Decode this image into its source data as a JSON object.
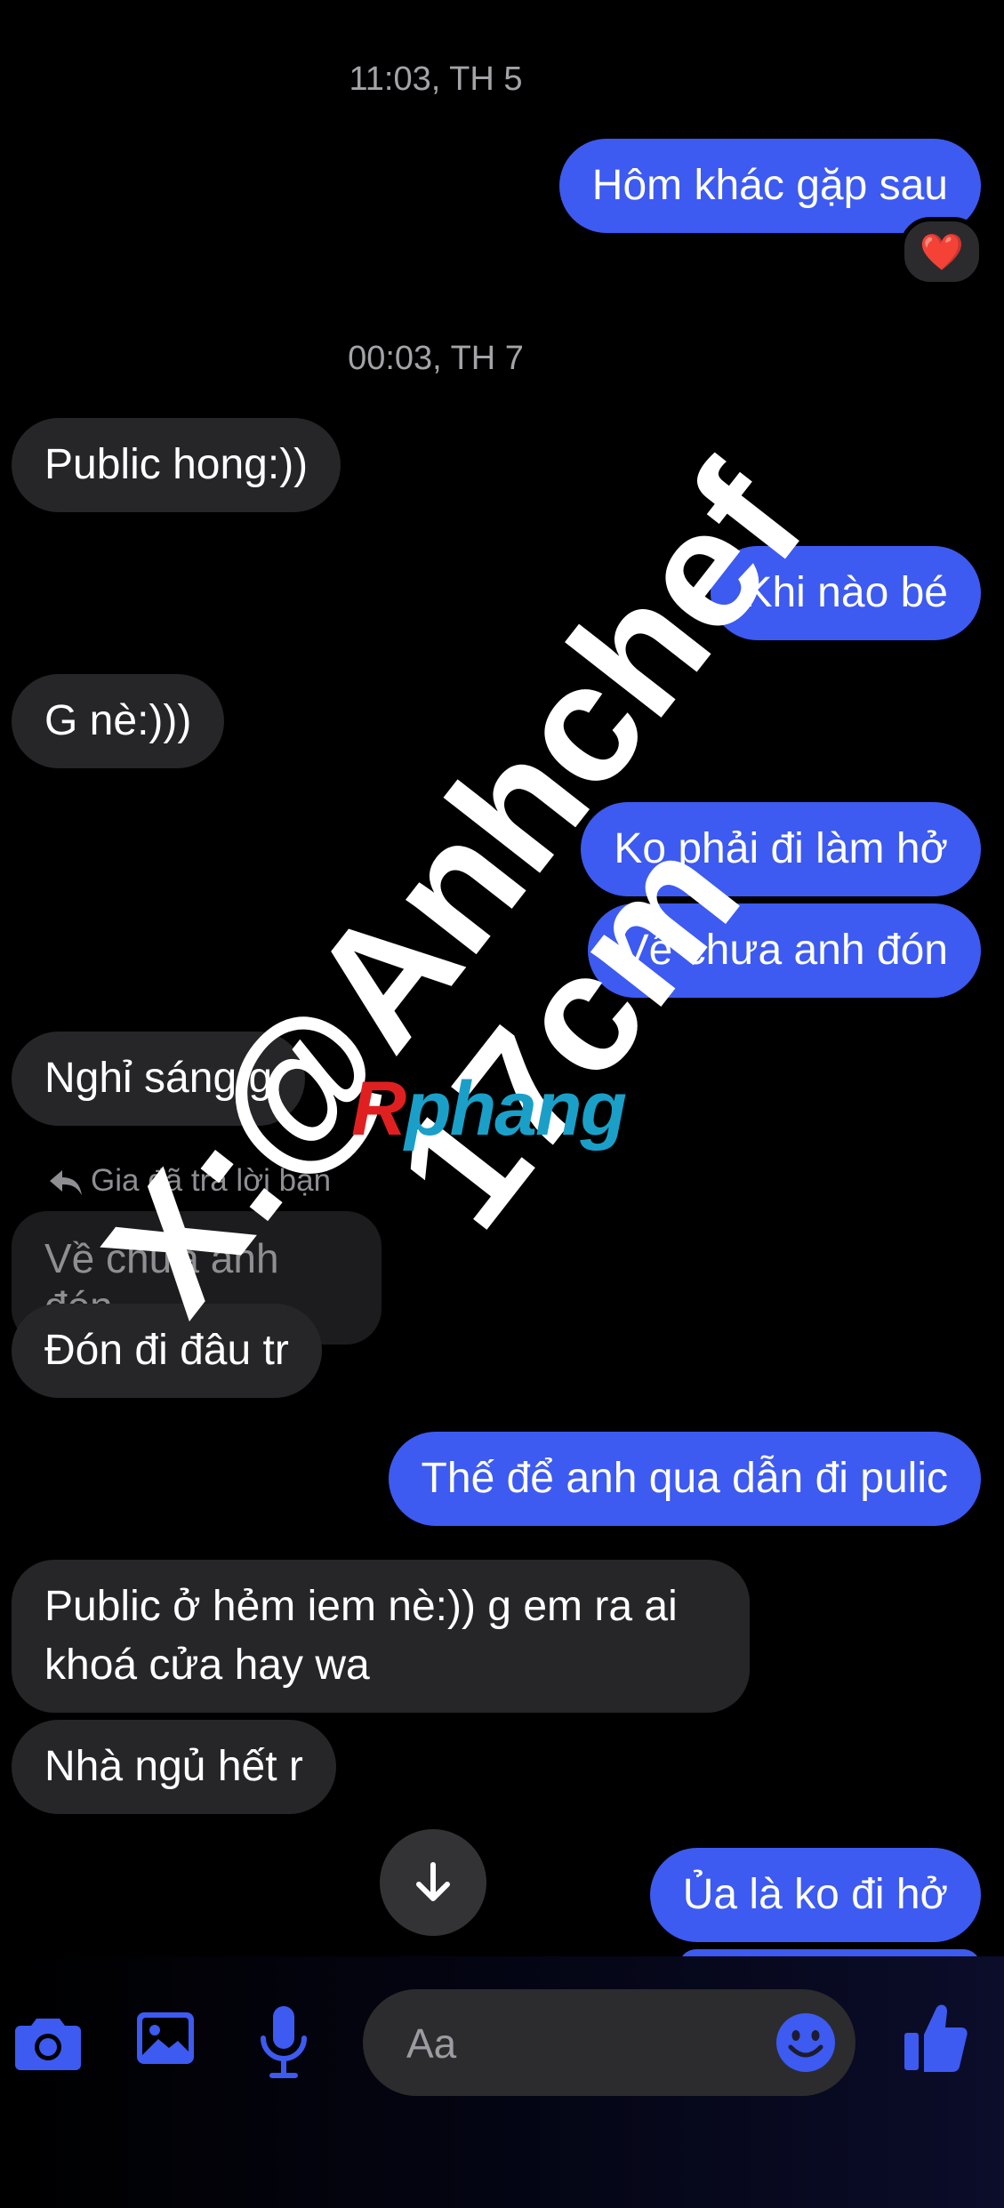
{
  "messages": [
    {
      "type": "time",
      "text": "11:03, TH 5"
    },
    {
      "type": "out",
      "text": "Hôm khác gặp sau",
      "reaction": "❤️"
    },
    {
      "type": "time",
      "text": "00:03, TH 7"
    },
    {
      "type": "in",
      "text": "Public hong:))"
    },
    {
      "type": "out",
      "text": "Khi nào bé"
    },
    {
      "type": "in",
      "text": "G nè:)))"
    },
    {
      "type": "out",
      "text": "Ko phải đi làm hở"
    },
    {
      "type": "out",
      "text": "Về chưa anh đón"
    },
    {
      "type": "in",
      "text": "Nghỉ sáng g"
    },
    {
      "type": "reply_note",
      "text": "Gia đã trả lời bạn"
    },
    {
      "type": "reply_quote",
      "text": "Về chưa anh đón"
    },
    {
      "type": "in",
      "text": "Đón đi đâu tr"
    },
    {
      "type": "out",
      "text": "Thế để anh qua dẫn đi pulic"
    },
    {
      "type": "in",
      "text": "Public ở hẻm iem nè:)) g em ra ai khoá cửa hay wa"
    },
    {
      "type": "in",
      "text": "Nhà ngủ hết r"
    },
    {
      "type": "out",
      "text": "Ủa là ko đi hở"
    }
  ],
  "composer": {
    "placeholder": "Aa",
    "icons": [
      "camera-icon",
      "gallery-icon",
      "microphone-icon",
      "emoji-icon",
      "thumbs-up-icon"
    ],
    "accent": "#3d5af1"
  },
  "watermark": {
    "line1": "X:@Anhchef",
    "line2": "17cm"
  },
  "logo": {
    "part1": "R",
    "part2": "phang"
  },
  "colors": {
    "outgoing": "#3d5af1",
    "incoming": "#262629",
    "background": "#000000"
  }
}
